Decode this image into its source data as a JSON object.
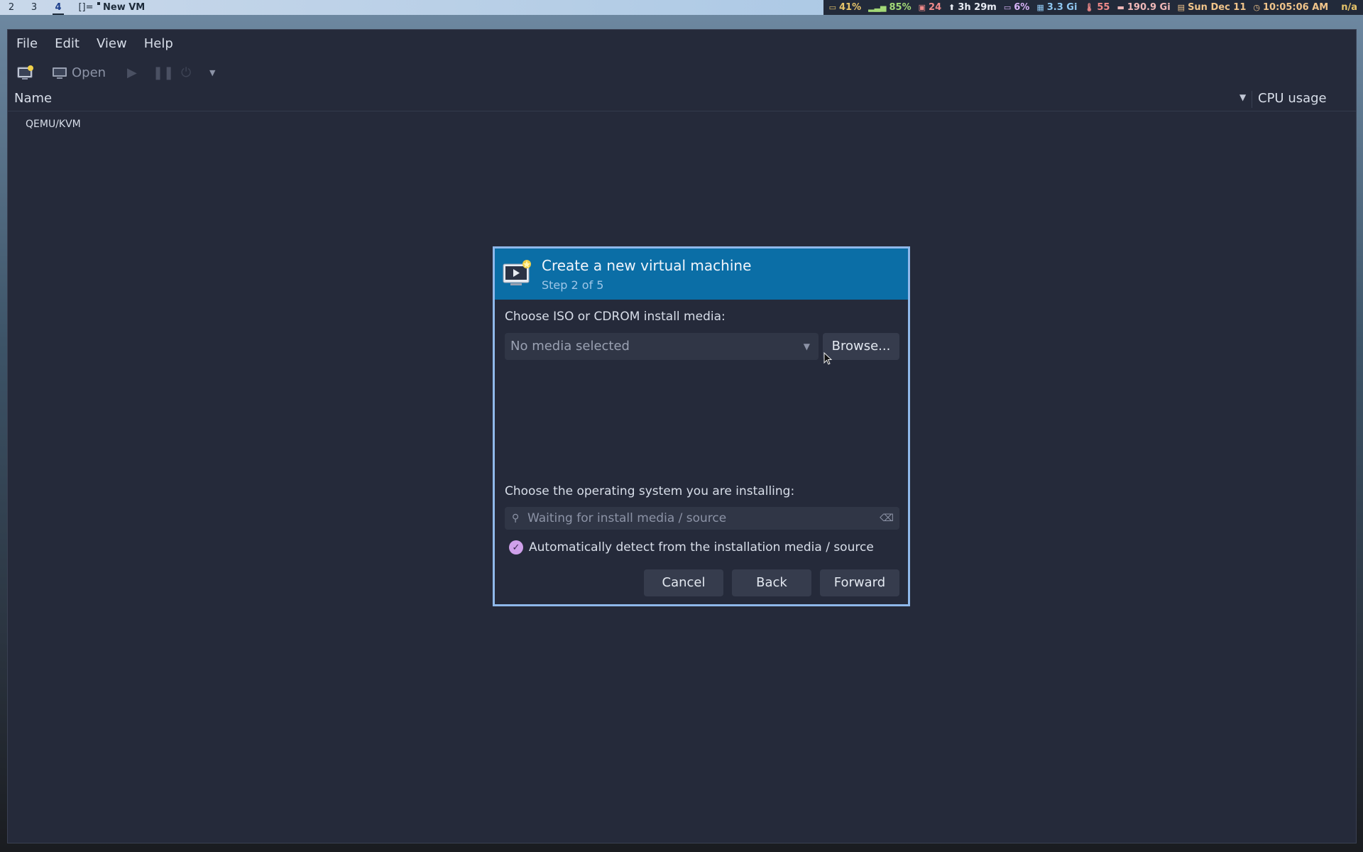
{
  "topbar": {
    "workspaces": [
      "2",
      "3",
      "4",
      "[]="
    ],
    "active_workspace": "4",
    "window_title": "New VM",
    "status": [
      {
        "icon": "laptop-icon",
        "value": "41%",
        "color": "#e7c46a"
      },
      {
        "icon": "signal-icon",
        "value": "85%",
        "color": "#a3d977"
      },
      {
        "icon": "package-icon",
        "value": "24",
        "color": "#f08a8a"
      },
      {
        "icon": "upload-icon",
        "value": "3h 29m",
        "color": "#e8ecf4"
      },
      {
        "icon": "monitor-icon",
        "value": "6%",
        "color": "#d8b4f8"
      },
      {
        "icon": "memory-icon",
        "value": "3.3 Gi",
        "color": "#8fc6f0"
      },
      {
        "icon": "thermometer-icon",
        "value": "55",
        "color": "#f08a8a"
      },
      {
        "icon": "disk-icon",
        "value": "190.9 Gi",
        "color": "#f0b8b8"
      },
      {
        "icon": "calendar-icon",
        "value": "Sun Dec 11",
        "color": "#f0c48a"
      },
      {
        "icon": "clock-icon",
        "value": "10:05:06 AM",
        "color": "#f0c48a"
      },
      {
        "icon": "",
        "value": "n/a",
        "color": "#e7c46a"
      }
    ]
  },
  "menubar": {
    "items": [
      "File",
      "Edit",
      "View",
      "Help"
    ]
  },
  "toolbar": {
    "open_label": "Open"
  },
  "list": {
    "col_name": "Name",
    "col_cpu": "CPU usage",
    "rows": [
      "QEMU/KVM"
    ]
  },
  "dialog": {
    "title": "Create a new virtual machine",
    "subtitle": "Step 2 of 5",
    "media_label": "Choose ISO or CDROM install media:",
    "media_value": "No media selected",
    "browse_label": "Browse...",
    "os_label": "Choose the operating system you are installing:",
    "os_placeholder": "Waiting for install media / source",
    "auto_detect_label": "Automatically detect from the installation media / source",
    "auto_detect_checked": true,
    "cancel_label": "Cancel",
    "back_label": "Back",
    "forward_label": "Forward"
  }
}
